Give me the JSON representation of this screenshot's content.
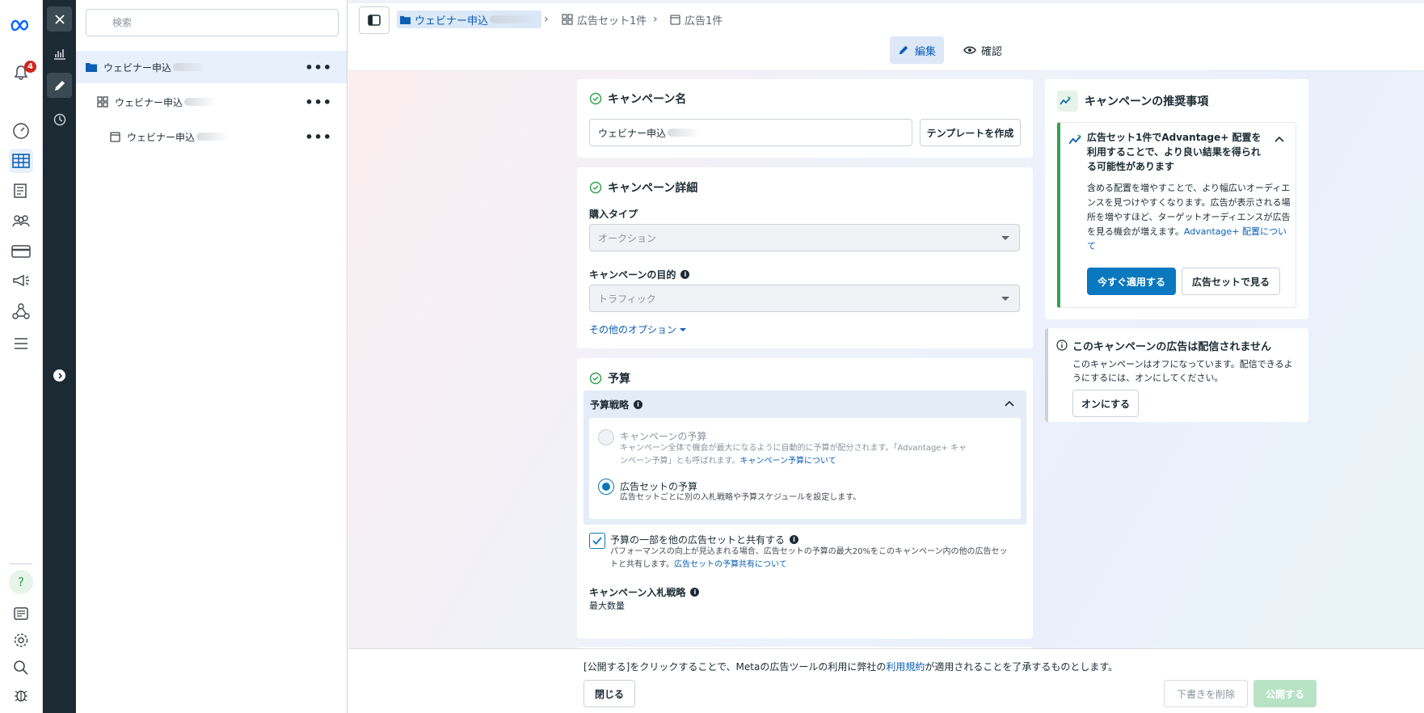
{
  "tree": {
    "search_placeholder": "検索",
    "items": [
      {
        "label": "ウェビナー申込",
        "more": "•••"
      },
      {
        "label": "ウェビナー申込",
        "more": "•••"
      },
      {
        "label": "ウェビナー申込",
        "more": "•••"
      }
    ]
  },
  "rail": {
    "notification_count": "4"
  },
  "breadcrumb": {
    "campaign": "ウェビナー申込",
    "adset": "広告セット1件",
    "ad": "広告1件"
  },
  "modes": {
    "edit": "編集",
    "review": "確認"
  },
  "campaign_name": {
    "title": "キャンペーン名",
    "value": "ウェビナー申込",
    "template_button": "テンプレートを作成"
  },
  "campaign_details": {
    "title": "キャンペーン詳細",
    "buying_type_label": "購入タイプ",
    "buying_type_value": "オークション",
    "objective_label": "キャンペーンの目的",
    "objective_value": "トラフィック",
    "more_options": "その他のオプション"
  },
  "budget": {
    "title": "予算",
    "strategy_label": "予算戦略",
    "campaign_budget_title": "キャンペーンの予算",
    "campaign_budget_desc": "キャンペーン全体で機会が最大になるように自動的に予算が配分されます。「Advantage+ キャンペーン予算」とも呼ばれます。",
    "campaign_budget_link": "キャンペーン予算について",
    "adset_budget_title": "広告セットの予算",
    "adset_budget_desc": "広告セットごとに別の入札戦略や予算スケジュールを設定します。",
    "share_label": "予算の一部を他の広告セットと共有する",
    "share_desc": "パフォーマンスの向上が見込まれる場合、広告セットの予算の最大20%をこのキャンペーン内の他の広告セットと共有します。",
    "share_link": "広告セットの予算共有について",
    "bid_label": "キャンペーン入札戦略",
    "bid_value": "最大数量"
  },
  "recommendations": {
    "title": "キャンペーンの推奨事項",
    "headline": "広告セット1件でAdvantage+ 配置を利用することで、より良い結果を得られる可能性があります",
    "body": "含める配置を増やすことで、より幅広いオーディエンスを見つけやすくなります。広告が表示される場所を増やすほど、ターゲットオーディエンスが広告を見る機会が増えます。",
    "link": "Advantage+ 配置について",
    "apply_button": "今すぐ適用する",
    "view_button": "広告セットで見る"
  },
  "notice": {
    "title": "このキャンペーンの広告は配信されません",
    "body": "このキャンペーンはオフになっています。配信できるようにするには、オンにしてください。",
    "button": "オンにする"
  },
  "footer": {
    "terms_prefix": "[公開する]をクリックすることで、Metaの広告ツールの利用に弊社の",
    "terms_link": "利用規約",
    "terms_suffix": "が適用されることを了承するものとします。",
    "close_button": "閉じる",
    "delete_draft_button": "下書きを削除",
    "publish_button": "公開する"
  },
  "colors": {
    "accent": "#0a78be",
    "link": "#0a5eb5",
    "success": "#31a24c",
    "dark_rail": "#1c2b33"
  }
}
